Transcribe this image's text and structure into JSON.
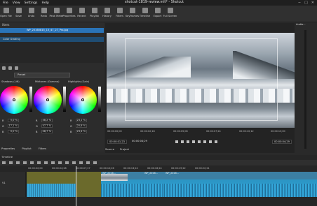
{
  "title": "shotcut-1819-review.mlt* - Shotcut",
  "menu": [
    "File",
    "View",
    "Settings",
    "Help"
  ],
  "window_buttons": [
    "−",
    "□",
    "✕"
  ],
  "toolbar": [
    {
      "label": "Open File",
      "icon": "folder-open-icon"
    },
    {
      "label": "Save",
      "icon": "save-icon"
    },
    {
      "label": "Undo",
      "icon": "undo-icon"
    },
    {
      "label": "Redo",
      "icon": "redo-icon"
    },
    {
      "label": "Peak Meter",
      "icon": "meter-icon"
    },
    {
      "label": "Properties",
      "icon": "properties-icon"
    },
    {
      "label": "Recent",
      "icon": "recent-icon"
    },
    {
      "label": "Playlist",
      "icon": "playlist-icon"
    },
    {
      "label": "History",
      "icon": "history-icon"
    },
    {
      "label": "Filters",
      "icon": "filters-icon"
    },
    {
      "label": "Keyframes",
      "icon": "keyframes-icon"
    },
    {
      "label": "Timeline",
      "icon": "timeline-icon"
    },
    {
      "label": "Export",
      "icon": "export-icon"
    },
    {
      "label": "Full Screen",
      "icon": "fullscreen-icon"
    }
  ],
  "filters_panel": {
    "header": "ilters",
    "clip_name": "WP_20160815_15_47_27_Pro.jpg",
    "filter_item": "Color Grading",
    "preset_value": "Preset"
  },
  "color_wheels": [
    {
      "label": "Shadows (Lift)",
      "values": [
        [
          "R",
          "5,0 %"
        ],
        [
          "G",
          "17,1 %"
        ],
        [
          "B",
          "0,0 %"
        ]
      ]
    },
    {
      "label": "Midtones (Gamma)",
      "values": [
        [
          "R",
          "48,2 %"
        ],
        [
          "G",
          "47,7 %"
        ],
        [
          "B",
          "48,7 %"
        ]
      ]
    },
    {
      "label": "Highlights (Gain)",
      "values": [
        [
          "R",
          "23,1 %"
        ],
        [
          "G",
          "20,6 %"
        ],
        [
          "B",
          "23,4 %"
        ]
      ]
    }
  ],
  "left_tabs": [
    "Properties",
    "Playlist",
    "Filters"
  ],
  "viewer": {
    "ruler_ticks": [
      "00:00:00;00",
      "00:00:02;18",
      "00:00:05;06",
      "00:00:07;24",
      "00:00:10;12",
      "00:00:13;00"
    ],
    "timecode_current": "00:00:01;23",
    "timecode_total": "00:00:04;29",
    "timecode_right": "00:00:04;29",
    "tabs": [
      "Source",
      "Project"
    ]
  },
  "audio_panel": {
    "header": "Audio..."
  },
  "timeline": {
    "header": "Timeline",
    "ruler_ticks": [
      "00:00:02;00",
      "00:00:04;28",
      "00:00:07;27",
      "00:00:10;26",
      "00:00:13;24",
      "00:00:16;24",
      "00:00:19;22",
      "00:00:22;21"
    ],
    "track_label": "V1",
    "clips": [
      {
        "title": "",
        "color": "#6b6a2c"
      },
      {
        "title": "WP_2016...",
        "color": "#3c7fa3"
      },
      {
        "title": "",
        "color": "#6b6a2c"
      },
      {
        "title": "WP_2016...",
        "color": "#3c7fa3"
      },
      {
        "title": "WP_2016...",
        "color": "#3c7fa3"
      },
      {
        "title": "WP_2016...",
        "color": "#3c7fa3"
      }
    ]
  }
}
